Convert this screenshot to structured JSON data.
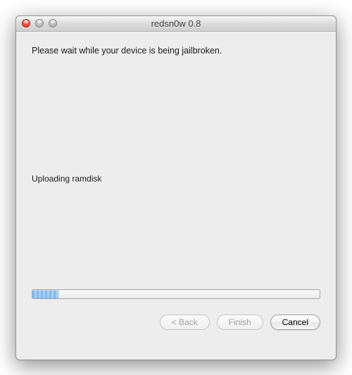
{
  "window": {
    "title": "redsn0w 0.8"
  },
  "content": {
    "main_message": "Please wait while your device is being jailbroken.",
    "status_message": "Uploading ramdisk",
    "progress_percent": 9
  },
  "buttons": {
    "back_label": "< Back",
    "finish_label": "Finish",
    "cancel_label": "Cancel"
  }
}
